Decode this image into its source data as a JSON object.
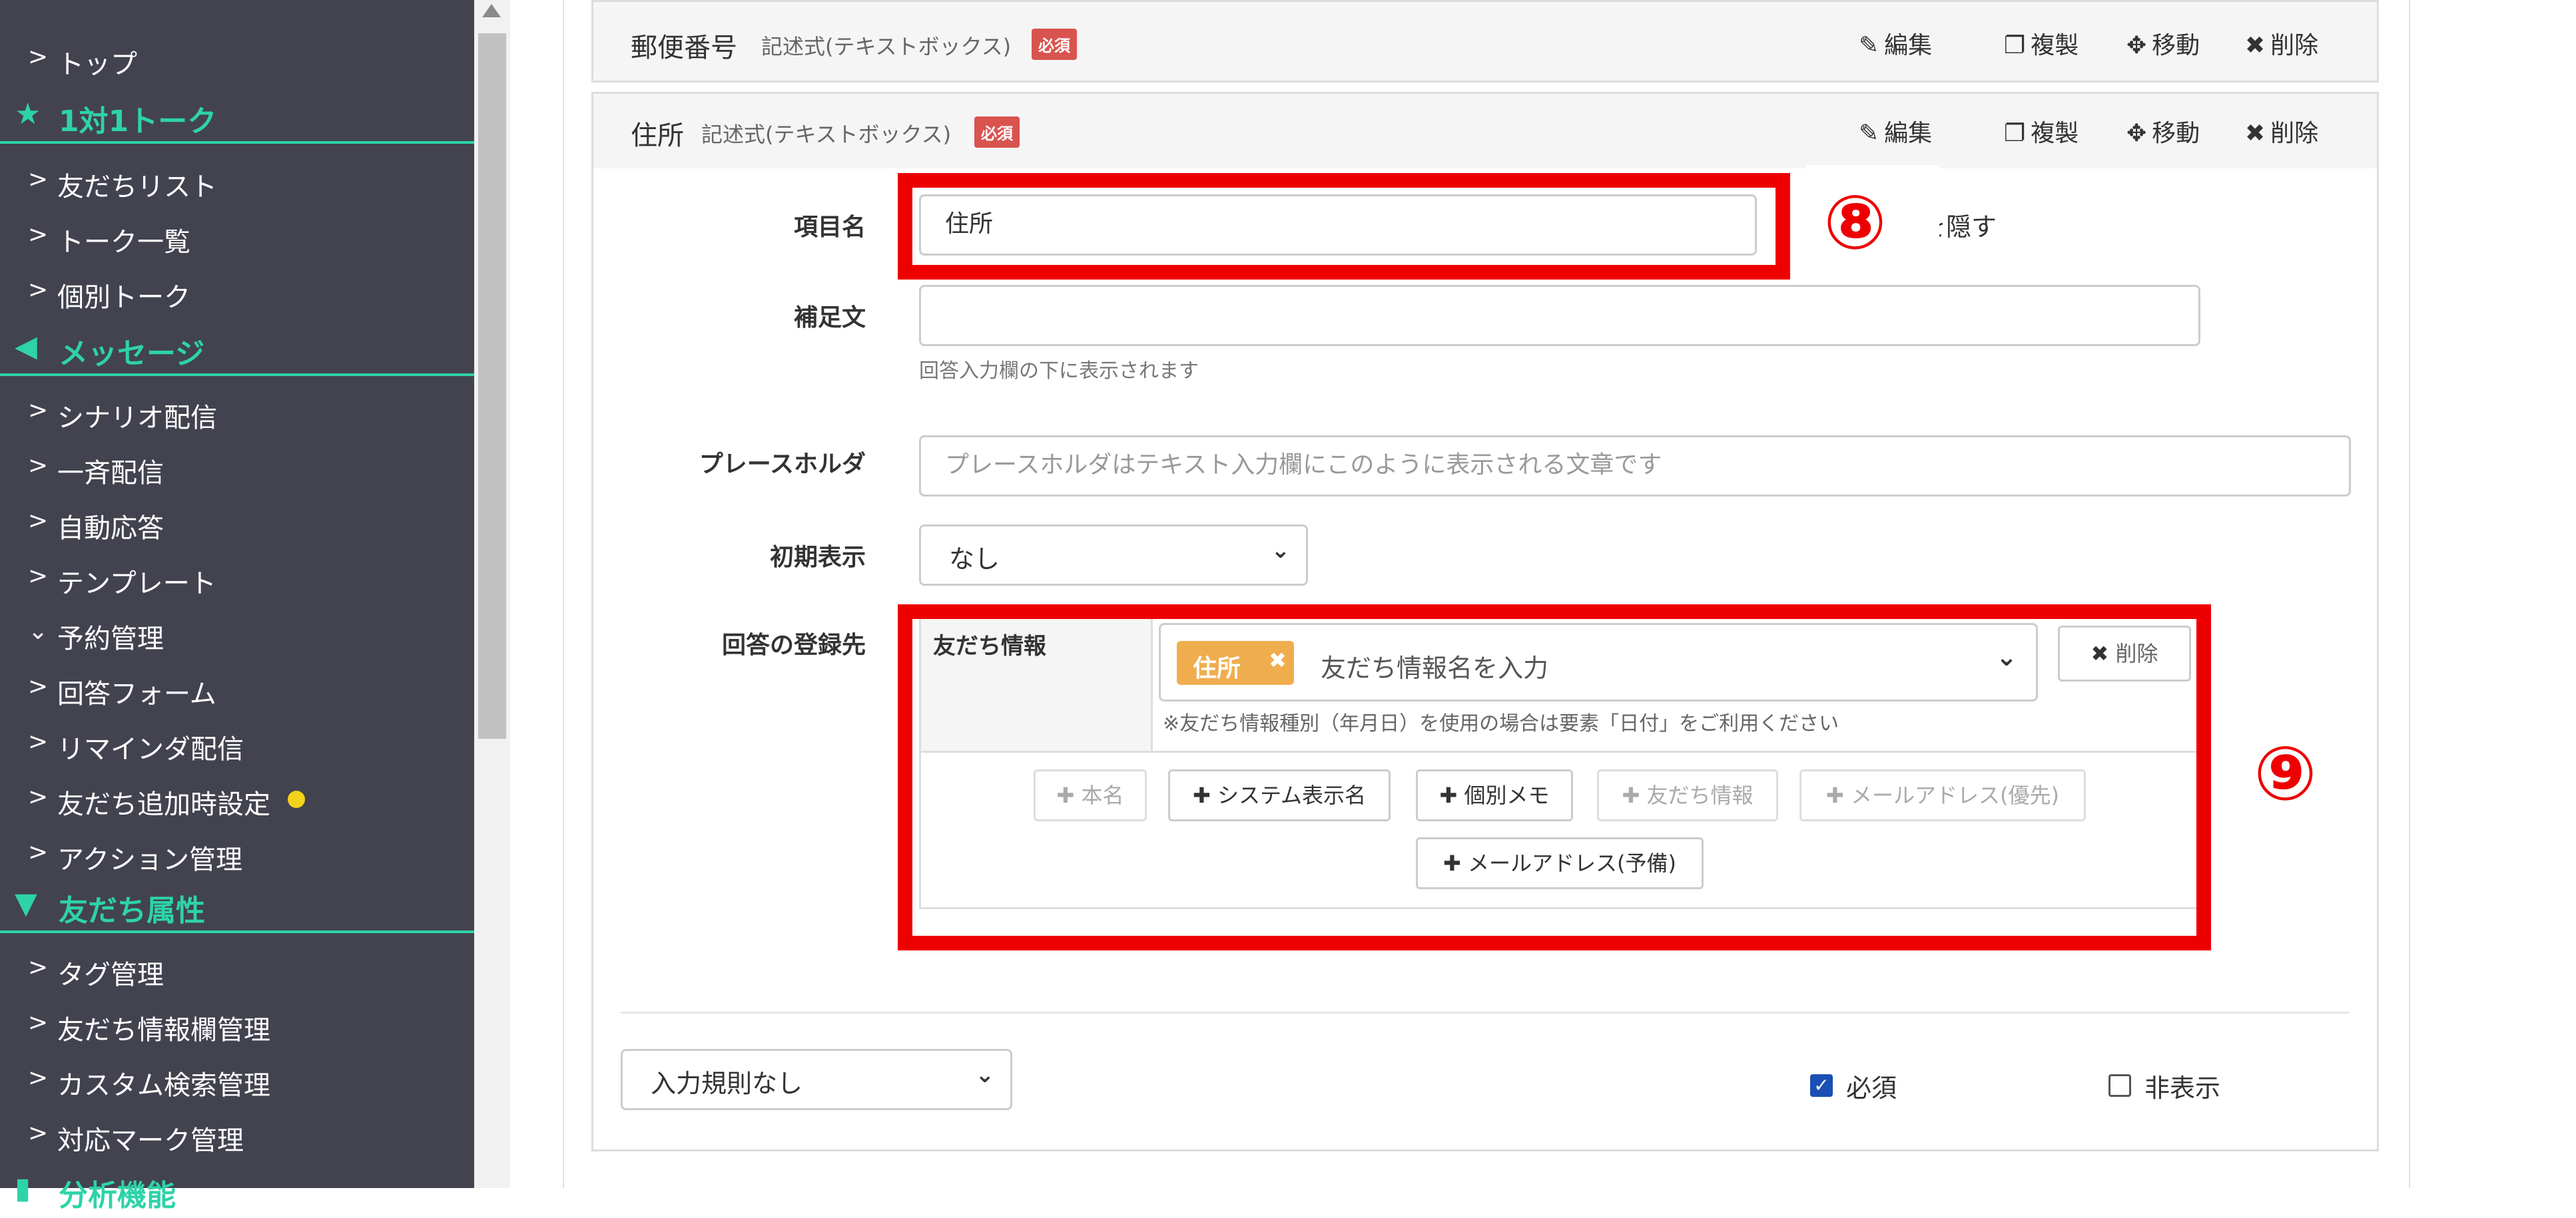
{
  "sidebar": {
    "items": [
      {
        "label": "トップ"
      },
      {
        "label": "友だちリスト"
      },
      {
        "label": "トーク一覧"
      },
      {
        "label": "個別トーク"
      },
      {
        "label": "シナリオ配信"
      },
      {
        "label": "一斉配信"
      },
      {
        "label": "自動応答"
      },
      {
        "label": "テンプレート"
      },
      {
        "label": "予約管理"
      },
      {
        "label": "回答フォーム"
      },
      {
        "label": "リマインダ配信"
      },
      {
        "label": "友だち追加時設定"
      },
      {
        "label": "アクション管理"
      },
      {
        "label": "タグ管理"
      },
      {
        "label": "友だち情報欄管理"
      },
      {
        "label": "カスタム検索管理"
      },
      {
        "label": "対応マーク管理"
      }
    ],
    "sections": [
      {
        "label": "1対1トーク",
        "icon": "star-icon"
      },
      {
        "label": "メッセージ",
        "icon": "megaphone-icon"
      },
      {
        "label": "友だち属性",
        "icon": "filter-icon"
      },
      {
        "label": "分析機能",
        "icon": "chart-icon"
      }
    ],
    "accent_color": "#2ed3a8",
    "notification_dot_color": "#f2d21a"
  },
  "postal_card": {
    "title": "郵便番号",
    "type": "記述式(テキストボックス)",
    "required_badge": "必須"
  },
  "address_card": {
    "title": "住所",
    "type": "記述式(テキストボックス)",
    "required_badge": "必須"
  },
  "actions": {
    "edit": "編集",
    "duplicate": "複製",
    "move": "移動",
    "delete": "削除"
  },
  "form": {
    "item_name_label": "項目名",
    "item_name_value": "住所",
    "hide_label_partial": "を隠す",
    "supplement_label": "補足文",
    "supplement_help": "回答入力欄の下に表示されます",
    "placeholder_label": "プレースホルダ",
    "placeholder_field_placeholder": "プレースホルダはテキスト入力欄にこのように表示される文章です",
    "initial_display_label": "初期表示",
    "initial_display_value": "なし",
    "destination_label": "回答の登録先"
  },
  "destination": {
    "row_label": "友だち情報",
    "tag_chip": "住所",
    "input_placeholder": "友だち情報名を入力",
    "delete_button": "削除",
    "note": "※友だち情報種別（年月日）を使用の場合は要素「日付」をご利用ください",
    "add_buttons": [
      {
        "label": "本名",
        "disabled": true
      },
      {
        "label": "システム表示名",
        "disabled": false
      },
      {
        "label": "個別メモ",
        "disabled": false
      },
      {
        "label": "友だち情報",
        "disabled": true
      },
      {
        "label": "メールアドレス(優先)",
        "disabled": true
      },
      {
        "label": "メールアドレス(予備)",
        "disabled": false
      }
    ]
  },
  "footer": {
    "validation_select": "入力規則なし",
    "required_label": "必須",
    "required_checked": true,
    "hidden_label": "非表示",
    "hidden_checked": false
  },
  "annotations": {
    "marker_8": "⑧",
    "marker_9": "⑨",
    "highlight_color": "#ee0000"
  }
}
